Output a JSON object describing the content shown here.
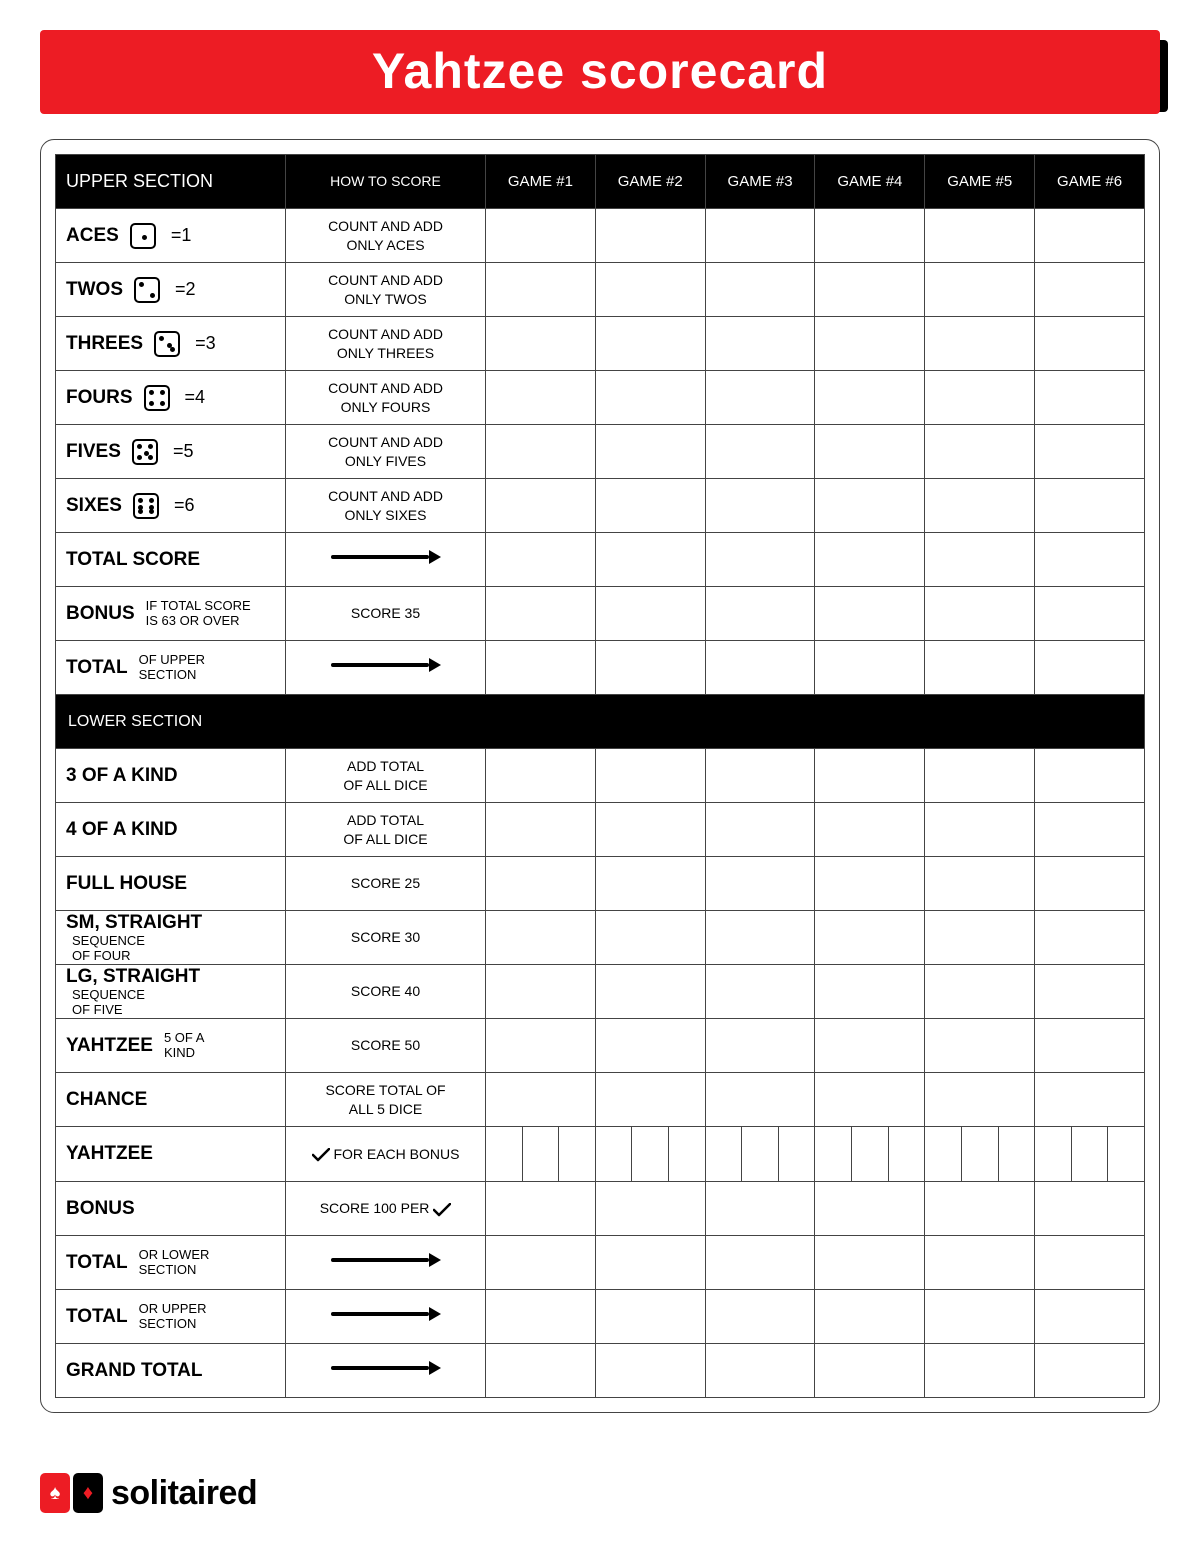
{
  "title": "Yahtzee scorecard",
  "upper_header": "UPPER SECTION",
  "how_header": "HOW TO SCORE",
  "games": [
    "GAME #1",
    "GAME #2",
    "GAME #3",
    "GAME #4",
    "GAME #5",
    "GAME #6"
  ],
  "upper_rows": [
    {
      "label": "ACES",
      "eq": "=1",
      "how": "COUNT AND ADD\nONLY ACES"
    },
    {
      "label": "TWOS",
      "eq": "=2",
      "how": "COUNT AND ADD\nONLY TWOS"
    },
    {
      "label": "THREES",
      "eq": "=3",
      "how": "COUNT AND ADD\nONLY THREES"
    },
    {
      "label": "FOURS",
      "eq": "=4",
      "how": "COUNT AND ADD\nONLY FOURS"
    },
    {
      "label": "FIVES",
      "eq": "=5",
      "how": "COUNT AND ADD\nONLY FIVES"
    },
    {
      "label": "SIXES",
      "eq": "=6",
      "how": "COUNT AND ADD\nONLY SIXES"
    }
  ],
  "total_score_label": "TOTAL SCORE",
  "bonus": {
    "main": "BONUS",
    "sub": "IF TOTAL SCORE\nIS 63 OR OVER",
    "how": "SCORE 35"
  },
  "total_upper": {
    "main": "TOTAL",
    "sub": "OF UPPER\nSECTION"
  },
  "lower_header": "LOWER SECTION",
  "lower_rows": [
    {
      "label": "3 OF A KIND",
      "how": "ADD TOTAL\nOF ALL DICE"
    },
    {
      "label": "4 OF A KIND",
      "how": "ADD TOTAL\nOF ALL DICE"
    },
    {
      "label": "FULL HOUSE",
      "how": "SCORE 25"
    },
    {
      "main": "SM, STRAIGHT",
      "sub": "SEQUENCE\nOF FOUR",
      "how": "SCORE 30"
    },
    {
      "main": "LG, STRAIGHT",
      "sub": "SEQUENCE\nOF FIVE",
      "how": "SCORE 40"
    },
    {
      "main": "YAHTZEE",
      "sub": "5 OF A\nKIND",
      "how": "SCORE 50"
    },
    {
      "label": "CHANCE",
      "how": "SCORE TOTAL OF\nALL 5 DICE"
    }
  ],
  "yahtzee_bonus_label": "YAHTZEE",
  "yahtzee_bonus_how": "FOR EACH BONUS",
  "bonus_row_label": "BONUS",
  "bonus_row_how": "SCORE 100 PER",
  "total_lower": {
    "main": "TOTAL",
    "sub": "OR LOWER\nSECTION"
  },
  "total_upper2": {
    "main": "TOTAL",
    "sub": "OR UPPER\nSECTION"
  },
  "grand_total": "GRAND TOTAL",
  "brand": "solitaired"
}
